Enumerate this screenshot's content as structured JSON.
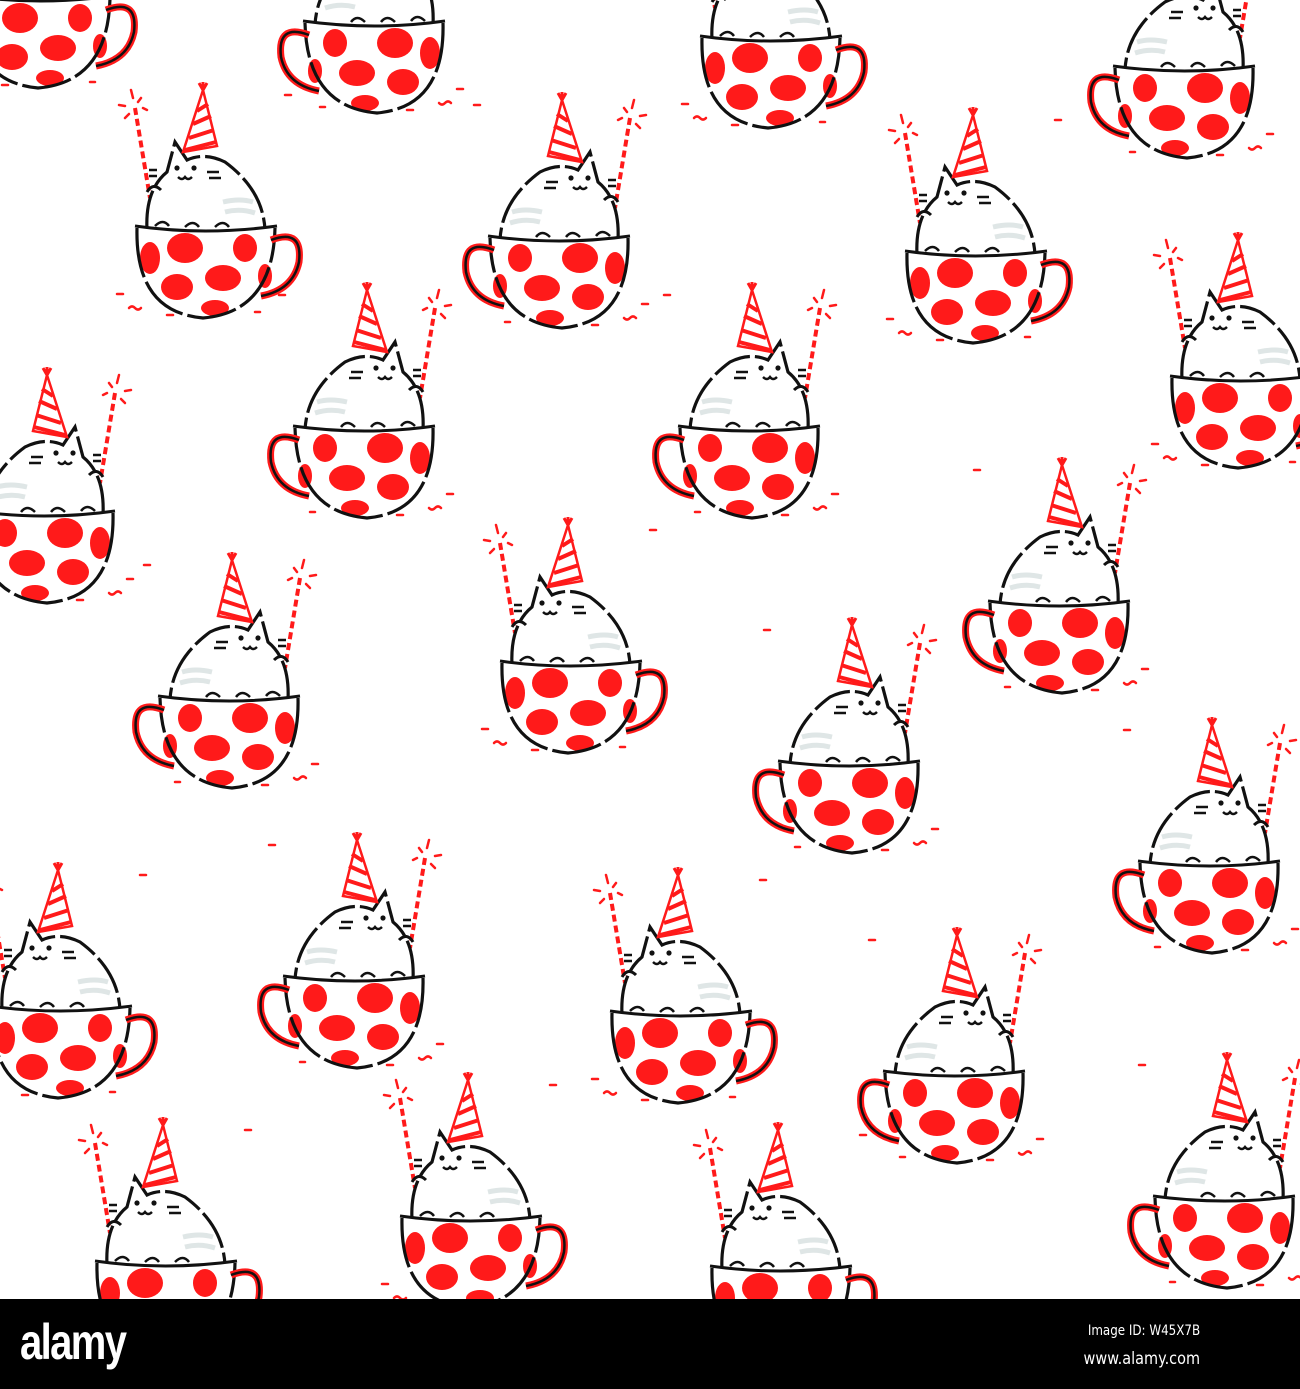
{
  "illustration": {
    "subject": "party cats in polka-dot teacups",
    "colors": {
      "accent": "#ff1a1a",
      "outline": "#111111",
      "shade": "#dfe6e6",
      "background": "#ffffff"
    }
  },
  "watermark": {
    "logo": "alamy",
    "image_id": "Image ID: W45X7B",
    "url": "www.alamy.com"
  }
}
